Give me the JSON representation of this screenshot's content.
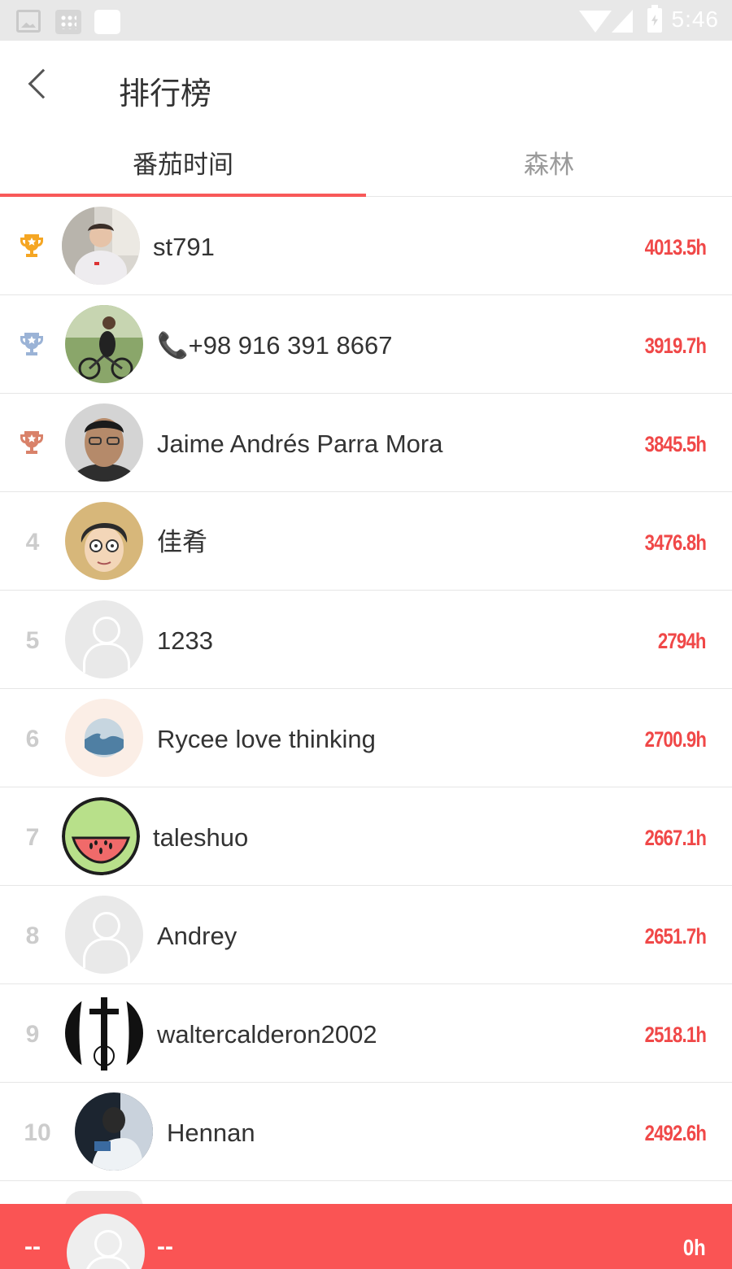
{
  "status_bar": {
    "time": "5:46"
  },
  "header": {
    "title": "排行榜"
  },
  "tabs": [
    {
      "label": "番茄时间",
      "active": true
    },
    {
      "label": "森林",
      "active": false
    }
  ],
  "colors": {
    "accent": "#f85959",
    "hours": "#f04848",
    "gold": "#f5a623",
    "silver": "#9bb3d6",
    "bronze": "#d9826a"
  },
  "leaderboard": [
    {
      "rank": "1",
      "badge": "gold-trophy-icon",
      "name": "st791",
      "hours": "4013.5h",
      "avatar": "photo"
    },
    {
      "rank": "2",
      "badge": "silver-trophy-icon",
      "name": "📞+98 916 391 8667",
      "hours": "3919.7h",
      "avatar": "photo"
    },
    {
      "rank": "3",
      "badge": "bronze-trophy-icon",
      "name": "Jaime Andrés Parra Mora",
      "hours": "3845.5h",
      "avatar": "photo"
    },
    {
      "rank": "4",
      "name": "佳肴",
      "hours": "3476.8h",
      "avatar": "cartoon"
    },
    {
      "rank": "5",
      "name": "1233",
      "hours": "2794h",
      "avatar": "default"
    },
    {
      "rank": "6",
      "name": "Rycee love thinking",
      "hours": "2700.9h",
      "avatar": "wave"
    },
    {
      "rank": "7",
      "name": "taleshuo",
      "hours": "2667.1h",
      "avatar": "watermelon"
    },
    {
      "rank": "8",
      "name": "Andrey",
      "hours": "2651.7h",
      "avatar": "default"
    },
    {
      "rank": "9",
      "name": "waltercalderon2002",
      "hours": "2518.1h",
      "avatar": "cross"
    },
    {
      "rank": "10",
      "name": "Hennan",
      "hours": "2492.6h",
      "avatar": "photo"
    }
  ],
  "my_rank": {
    "rank": "--",
    "name": "--",
    "hours": "0h"
  }
}
